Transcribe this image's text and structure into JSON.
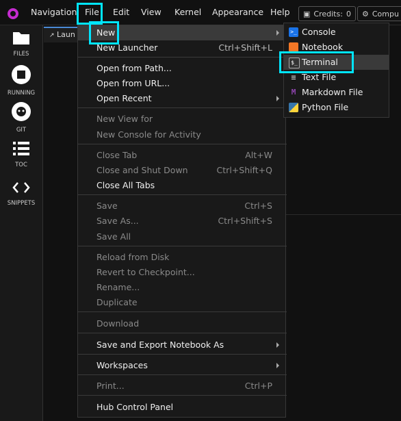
{
  "topbar": {
    "menus": [
      "Navigation",
      "File",
      "Edit",
      "View",
      "Kernel",
      "Appearance",
      "Help"
    ],
    "credits_label": "Credits:",
    "credits_value": "0",
    "compute_label": "Compu"
  },
  "sidebar": {
    "items": [
      {
        "label": "FILES",
        "icon": "folder-icon"
      },
      {
        "label": "RUNNING",
        "icon": "stop-circle-icon"
      },
      {
        "label": "GIT",
        "icon": "github-icon"
      },
      {
        "label": "TOC",
        "icon": "list-icon"
      },
      {
        "label": "SNIPPETS",
        "icon": "code-icon"
      }
    ]
  },
  "tab": {
    "label": "Laun"
  },
  "file_menu": {
    "items": [
      {
        "label": "New",
        "shortcut": "",
        "disabled": false,
        "submenu": true,
        "active": true
      },
      {
        "label": "New Launcher",
        "shortcut": "Ctrl+Shift+L",
        "disabled": false
      },
      {
        "label": "Open from Path...",
        "shortcut": "",
        "disabled": false
      },
      {
        "label": "Open from URL...",
        "shortcut": "",
        "disabled": false
      },
      {
        "label": "Open Recent",
        "shortcut": "",
        "disabled": false,
        "submenu": true
      },
      {
        "label": "New View for",
        "shortcut": "",
        "disabled": true
      },
      {
        "label": "New Console for Activity",
        "shortcut": "",
        "disabled": true
      },
      {
        "label": "Close Tab",
        "shortcut": "Alt+W",
        "disabled": true
      },
      {
        "label": "Close and Shut Down",
        "shortcut": "Ctrl+Shift+Q",
        "disabled": true
      },
      {
        "label": "Close All Tabs",
        "shortcut": "",
        "disabled": false
      },
      {
        "label": "Save",
        "shortcut": "Ctrl+S",
        "disabled": true
      },
      {
        "label": "Save As...",
        "shortcut": "Ctrl+Shift+S",
        "disabled": true
      },
      {
        "label": "Save All",
        "shortcut": "",
        "disabled": true
      },
      {
        "label": "Reload from Disk",
        "shortcut": "",
        "disabled": true
      },
      {
        "label": "Revert to Checkpoint...",
        "shortcut": "",
        "disabled": true
      },
      {
        "label": "Rename...",
        "shortcut": "",
        "disabled": true
      },
      {
        "label": "Duplicate",
        "shortcut": "",
        "disabled": true
      },
      {
        "label": "Download",
        "shortcut": "",
        "disabled": true
      },
      {
        "label": "Save and Export Notebook As",
        "shortcut": "",
        "disabled": false,
        "submenu": true
      },
      {
        "label": "Workspaces",
        "shortcut": "",
        "disabled": false,
        "submenu": true
      },
      {
        "label": "Print...",
        "shortcut": "Ctrl+P",
        "disabled": true
      },
      {
        "label": "Hub Control Panel",
        "shortcut": "",
        "disabled": false
      }
    ]
  },
  "new_submenu": {
    "items": [
      {
        "label": "Console",
        "icon": "console-icon",
        "color": "#1a73e8"
      },
      {
        "label": "Notebook",
        "icon": "notebook-icon",
        "color": "#f37726"
      },
      {
        "label": "Terminal",
        "icon": "terminal-icon",
        "color": "#333333"
      },
      {
        "label": "Text File",
        "icon": "text-file-icon",
        "color": "#dddddd"
      },
      {
        "label": "Markdown File",
        "icon": "markdown-icon",
        "color": "#8e44ad"
      },
      {
        "label": "Python File",
        "icon": "python-icon",
        "color": "#3776ab"
      }
    ]
  },
  "colors": {
    "highlight": "#00e5ff",
    "accent": "#4b8ad6",
    "logo": "#c52bd0"
  }
}
